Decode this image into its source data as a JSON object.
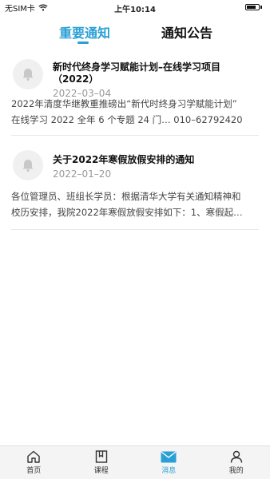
{
  "status_bar": {
    "carrier": "无SIM卡",
    "time": "上午10:14"
  },
  "tabs": [
    {
      "label": "重要通知",
      "active": true
    },
    {
      "label": "通知公告",
      "active": false
    }
  ],
  "notices": [
    {
      "title": "新时代终身学习赋能计划–在线学习项目（2022）",
      "date": "2022–03–04",
      "body_line1": "2022年清度华继教重推磅出“新代时终身习学赋能计划”",
      "body_line2": "在线学习 2022 全年 6 个专题 24 门… 010–62792420",
      "icon": "bell-icon"
    },
    {
      "title": "关于2022年寒假放假安排的通知",
      "date": "2022–01–20",
      "body_line1": "各位管理员、班组长学员：根据清华大学有关通知精神和",
      "body_line2": "校历安排，我院2022年寒假放假安排如下：1、寒假起…",
      "icon": "bell-icon"
    }
  ],
  "bottom_nav": [
    {
      "label": "首页",
      "icon": "home-icon",
      "active": false
    },
    {
      "label": "课程",
      "icon": "book-icon",
      "active": false
    },
    {
      "label": "消息",
      "icon": "mail-icon",
      "active": true
    },
    {
      "label": "我的",
      "icon": "person-icon",
      "active": false
    }
  ],
  "colors": {
    "accent": "#2a9fd6",
    "text": "#222222",
    "muted": "#999999"
  }
}
